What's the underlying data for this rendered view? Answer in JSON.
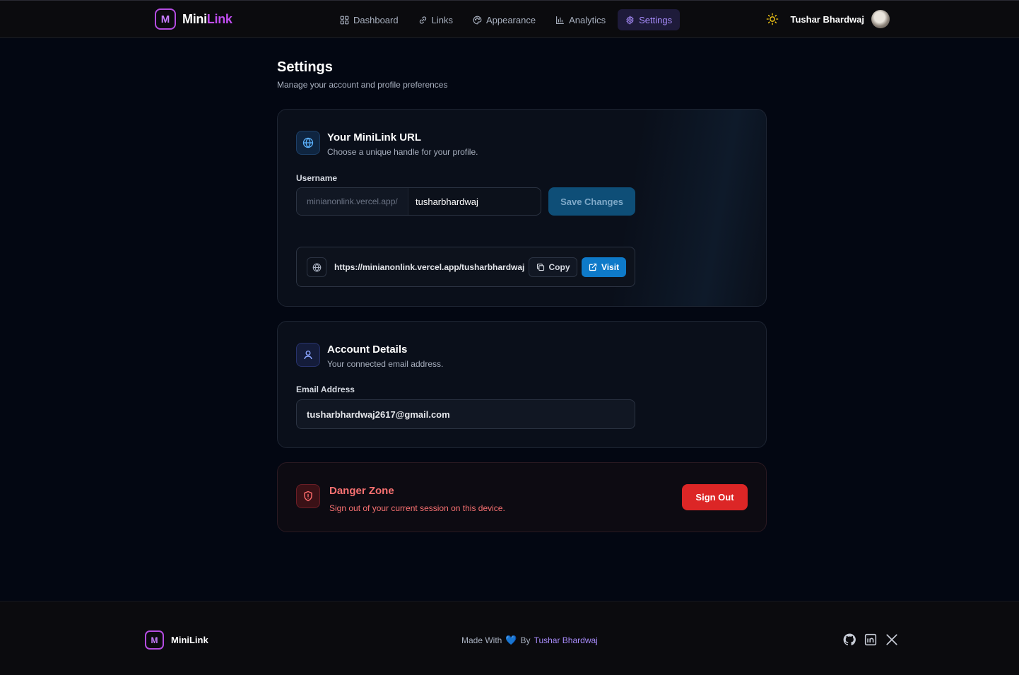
{
  "brand": {
    "logo_letter": "M",
    "name_part1": "Mini",
    "name_part2": "Link"
  },
  "nav": [
    {
      "label": "Dashboard",
      "icon": "grid-icon"
    },
    {
      "label": "Links",
      "icon": "link-icon"
    },
    {
      "label": "Appearance",
      "icon": "palette-icon"
    },
    {
      "label": "Analytics",
      "icon": "bar-chart-icon"
    },
    {
      "label": "Settings",
      "icon": "gear-icon",
      "active": true
    }
  ],
  "user": {
    "name": "Tushar Bhardwaj",
    "theme_icon": "sun-icon"
  },
  "page": {
    "title": "Settings",
    "subtitle": "Manage your account and profile preferences"
  },
  "url_card": {
    "title": "Your MiniLink URL",
    "description": "Choose a unique handle for your profile.",
    "username_label": "Username",
    "prefix": "minianonlink.vercel.app/",
    "username_value": "tusharbhardwaj",
    "save_label": "Save Changes",
    "full_url": "https://minianonlink.vercel.app/tusharbhardwaj",
    "copy_label": "Copy",
    "visit_label": "Visit"
  },
  "account_card": {
    "title": "Account Details",
    "description": "Your connected email address.",
    "email_label": "Email Address",
    "email_value": "tusharbhardwaj2617@gmail.com"
  },
  "danger_card": {
    "title": "Danger Zone",
    "description": "Sign out of your current session on this device.",
    "signout_label": "Sign Out"
  },
  "footer": {
    "brand_name": "MiniLink",
    "credit_prefix": "Made With",
    "credit_heart": "💙",
    "credit_by": "By",
    "credit_author": "Tushar Bhardwaj",
    "socials": [
      "github-icon",
      "linkedin-icon",
      "x-icon"
    ]
  },
  "colors": {
    "accent": "#a78bfa",
    "brand": "#c04df0",
    "primary": "#0e7ac9",
    "danger": "#dc2626"
  }
}
